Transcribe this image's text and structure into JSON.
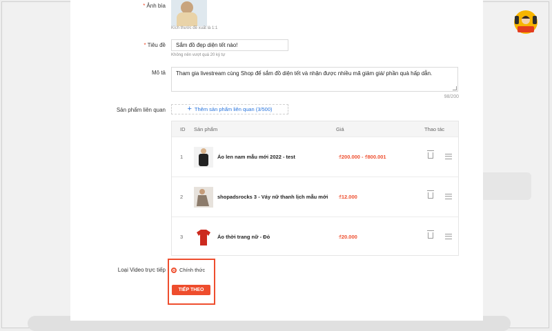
{
  "form": {
    "cover_label": "Ảnh bìa",
    "cover_hint": "Kích thước đề xuất là 1:1",
    "title_label": "Tiêu đề",
    "title_value": "Sắm đồ đẹp diện tết nào!",
    "title_hint": "Không nên vượt quá 20 ký tự",
    "desc_label": "Mô tả",
    "desc_value": "Tham gia livestream cùng Shop để sắm đồ diện tết và nhận được nhiều mã giảm giá/ phần quà hấp dẫn.",
    "desc_counter": "98/200",
    "products_label": "Sản phẩm liên quan",
    "add_products_label": "Thêm sản phẩm liên quan (3/500)",
    "video_type_label": "Loại Video trực tiếp",
    "video_type_option": "Chính thức",
    "next_button": "TIẾP THEO"
  },
  "table": {
    "headers": {
      "id": "ID",
      "product": "Sản phẩm",
      "price": "Giá",
      "actions": "Thao tác"
    },
    "rows": [
      {
        "id": "1",
        "name": "Áo len nam mẫu mới 2022 - test",
        "price": "₫200.000 - ₫800.001",
        "thumb_color": "#222222"
      },
      {
        "id": "2",
        "name": "shopadsrocks 3 - Váy nữ thanh lịch mẫu mới",
        "price": "₫12.000",
        "thumb_color": "#8c7b6b"
      },
      {
        "id": "3",
        "name": "Áo thời trang nữ - Đỏ",
        "price": "₫20.000",
        "thumb_color": "#cc2a1e"
      }
    ]
  },
  "colors": {
    "accent": "#ee4d2d",
    "link": "#2673dd"
  }
}
